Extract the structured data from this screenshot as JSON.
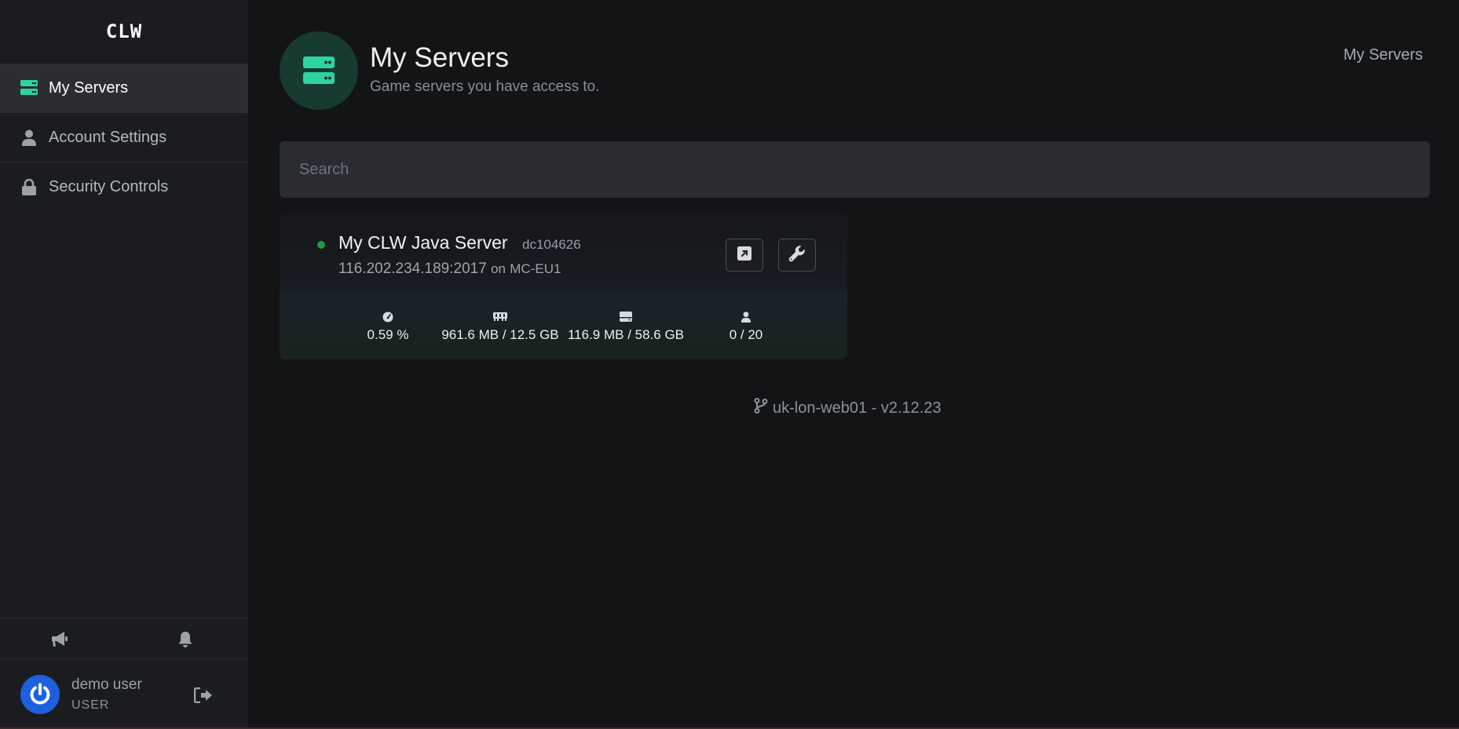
{
  "app": {
    "logo": "CLW"
  },
  "sidebar": {
    "items": [
      {
        "label": "My Servers",
        "icon": "server-icon",
        "active": true
      },
      {
        "label": "Account Settings",
        "icon": "user-icon",
        "active": false
      },
      {
        "label": "Security Controls",
        "icon": "lock-icon",
        "active": false
      }
    ],
    "bottom_icons": [
      "megaphone-icon",
      "bell-icon"
    ],
    "user": {
      "name": "demo user",
      "role": "USER"
    }
  },
  "header": {
    "title": "My Servers",
    "subtitle": "Game servers you have access to.",
    "breadcrumb": "My Servers"
  },
  "search": {
    "placeholder": "Search",
    "value": ""
  },
  "servers": [
    {
      "name": "My CLW Java Server",
      "id": "dc104626",
      "address": "116.202.234.189:2017",
      "on_text": "on",
      "node": "MC-EU1",
      "status": "online",
      "stats": {
        "cpu": "0.59 %",
        "memory": "961.6 MB / 12.5 GB",
        "disk": "116.9 MB / 58.6 GB",
        "players": "0 / 20"
      }
    }
  ],
  "footer": {
    "text": "uk-lon-web01 - v2.12.23"
  },
  "colors": {
    "accent": "#2fd3a0",
    "online": "#1f9a3a",
    "avatar": "#1e5fe0"
  }
}
